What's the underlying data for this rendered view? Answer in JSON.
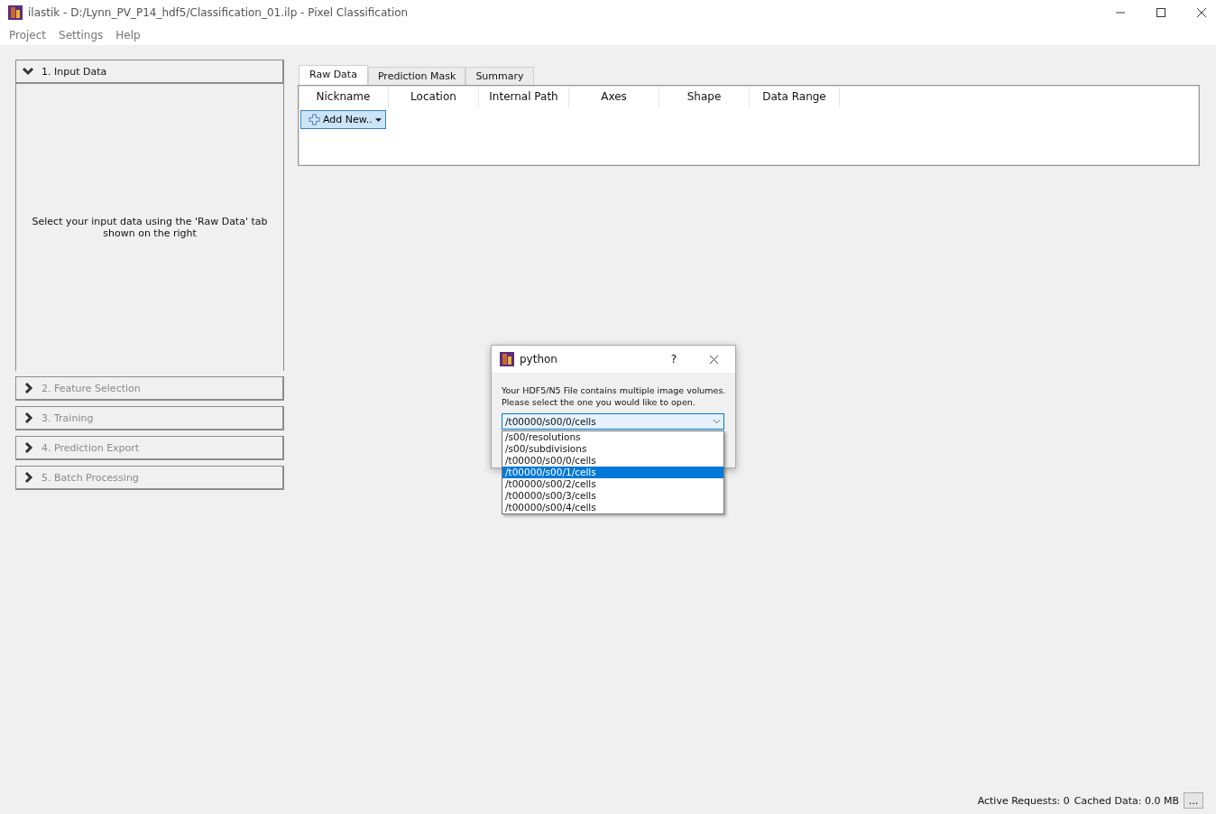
{
  "window": {
    "title": "ilastik - D:/Lynn_PV_P14_hdf5/Classification_01.ilp - Pixel Classification"
  },
  "menu": [
    "Project",
    "Settings",
    "Help"
  ],
  "applets": [
    {
      "label": "1. Input Data",
      "expanded": true,
      "disabled": false,
      "message": "Select your input data using the 'Raw Data' tab shown on the right"
    },
    {
      "label": "2. Feature Selection",
      "expanded": false,
      "disabled": true
    },
    {
      "label": "3. Training",
      "expanded": false,
      "disabled": true
    },
    {
      "label": "4. Prediction Export",
      "expanded": false,
      "disabled": true
    },
    {
      "label": "5. Batch Processing",
      "expanded": false,
      "disabled": true
    }
  ],
  "tabs": [
    {
      "label": "Raw Data",
      "selected": true
    },
    {
      "label": "Prediction Mask",
      "selected": false
    },
    {
      "label": "Summary",
      "selected": false
    }
  ],
  "table": {
    "columns": [
      "Nickname",
      "Location",
      "Internal Path",
      "Axes",
      "Shape",
      "Data Range"
    ],
    "add_button": "Add New.."
  },
  "dialog": {
    "title": "python",
    "help": "?",
    "message": "Your HDF5/N5 File contains multiple image volumes.\nPlease select the one you would like to open.",
    "combo_value": "/t00000/s00/0/cells",
    "options": [
      {
        "label": "/s00/resolutions",
        "selected": false
      },
      {
        "label": "/s00/subdivisions",
        "selected": false
      },
      {
        "label": "/t00000/s00/0/cells",
        "selected": false
      },
      {
        "label": "/t00000/s00/1/cells",
        "selected": true
      },
      {
        "label": "/t00000/s00/2/cells",
        "selected": false
      },
      {
        "label": "/t00000/s00/3/cells",
        "selected": false
      },
      {
        "label": "/t00000/s00/4/cells",
        "selected": false
      }
    ]
  },
  "status_bar": {
    "active_requests": "Active Requests: 0",
    "cached_data": "Cached Data: 0.0 MB",
    "more_button": "..."
  }
}
